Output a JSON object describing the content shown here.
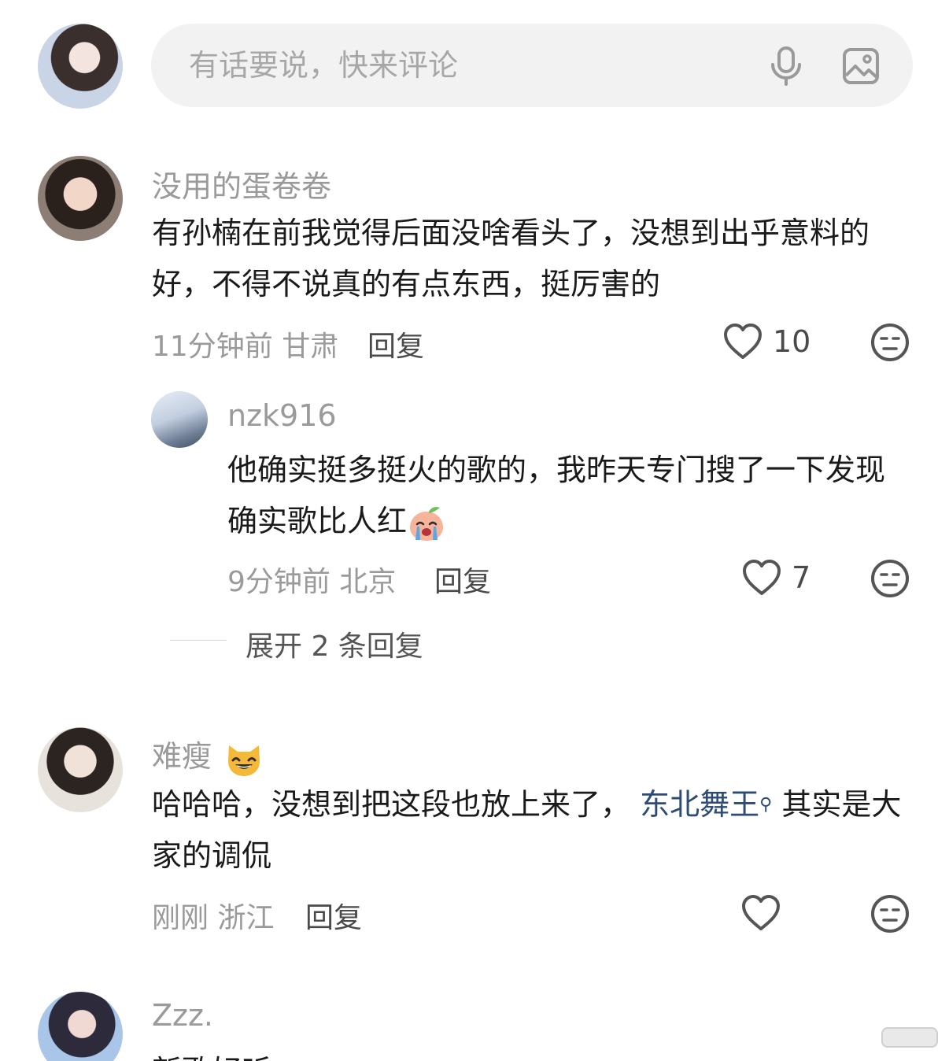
{
  "composer": {
    "placeholder": "有话要说，快来评论"
  },
  "comments": [
    {
      "username": "没用的蛋卷卷",
      "text": "有孙楠在前我觉得后面没啥看头了，没想到出乎意料的好，不得不说真的有点东西，挺厉害的",
      "time_location": "11分钟前 甘肃",
      "reply_label": "回复",
      "likes": "10"
    },
    {
      "username": "难瘦",
      "text_before": "哈哈哈，没想到把这段也放上来了，",
      "hashtag": "东北舞王",
      "text_after": "其实是大家的调侃",
      "time_location": "刚刚 浙江",
      "reply_label": "回复",
      "likes": ""
    },
    {
      "username": "Zzz.",
      "text": "新歌好听"
    }
  ],
  "reply": {
    "username": "nzk916",
    "text": "他确实挺多挺火的歌的，我昨天专门搜了一下发现确实歌比人红",
    "time_location": "9分钟前 北京",
    "reply_label": "回复",
    "likes": "7"
  },
  "expand_label": "展开 2 条回复",
  "colors": {
    "hashtag": "#2d4b73",
    "muted": "#9a9a9a",
    "input_bg": "#f2f2f2"
  },
  "icons": [
    "mic-icon",
    "image-icon",
    "heart-icon",
    "dislike-face-icon",
    "grinning-cat-emoji",
    "crying-peach-emoji",
    "search-icon"
  ]
}
